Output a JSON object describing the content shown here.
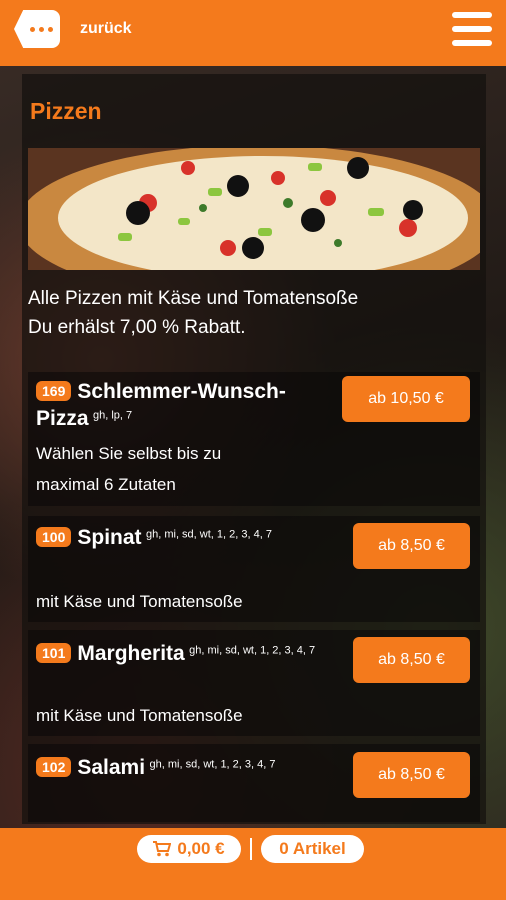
{
  "header": {
    "back_label": "zurück"
  },
  "category": {
    "title": "Pizzen",
    "description_line1": "Alle Pizzen mit Käse und Tomatensoße",
    "description_line2": "Du erhälst 7,00 % Rabatt."
  },
  "items": [
    {
      "number": "169",
      "name": "Schlemmer-Wunsch-Pizza",
      "allergens": "gh, lp, 7",
      "description_line1": "Wählen Sie selbst bis zu",
      "description_line2": "maximal 6 Zutaten",
      "price": "ab 10,50 €"
    },
    {
      "number": "100",
      "name": "Spinat",
      "allergens": "gh, mi, sd, wt, 1, 2, 3, 4, 7",
      "description_line1": "mit Käse und Tomatensoße",
      "price": "ab 8,50 €"
    },
    {
      "number": "101",
      "name": "Margherita",
      "allergens": "gh, mi, sd, wt, 1, 2, 3, 4, 7",
      "description_line1": "mit Käse und Tomatensoße",
      "price": "ab 8,50 €"
    },
    {
      "number": "102",
      "name": "Salami",
      "allergens": "gh, mi, sd, wt, 1, 2, 3, 4, 7",
      "price": "ab 8,50 €"
    }
  ],
  "footer": {
    "cart_total": "0,00 €",
    "article_count": "0 Artikel"
  },
  "colors": {
    "accent": "#f47a1c",
    "text": "#ffffff"
  },
  "icons": {
    "back": "back-icon",
    "menu": "hamburger-menu-icon",
    "cart": "cart-icon"
  }
}
